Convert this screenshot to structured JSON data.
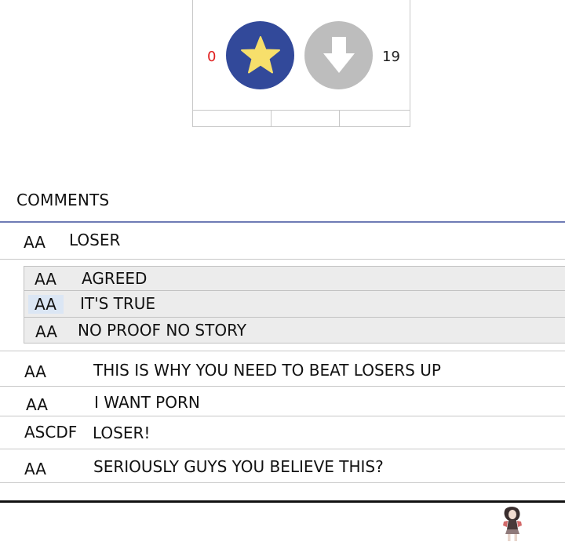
{
  "votes": {
    "up_count": "0",
    "down_count": "19",
    "up_icon": "star-icon",
    "down_icon": "arrow-down-icon",
    "up_color": "#32499a",
    "star_color": "#f7df6b",
    "down_color": "#bdbdbd",
    "up_count_color": "#e02020"
  },
  "comments": {
    "title": "COMMENTS",
    "items": [
      {
        "author": "AA",
        "text": "LOSER"
      },
      {
        "author": "AA",
        "text": "THIS IS WHY YOU NEED TO BEAT LOSERS UP"
      },
      {
        "author": "AA",
        "text": "I WANT PORN"
      },
      {
        "author": "ASCDF",
        "text": "LOSER!"
      },
      {
        "author": "AA",
        "text": "SERIOUSLY GUYS YOU BELIEVE THIS?"
      }
    ],
    "replies": [
      {
        "author": "AA",
        "text": "AGREED"
      },
      {
        "author": "AA",
        "text": "IT'S TRUE"
      },
      {
        "author": "AA",
        "text": "NO PROOF NO STORY"
      }
    ]
  },
  "accent_color": "#6e7bb5"
}
